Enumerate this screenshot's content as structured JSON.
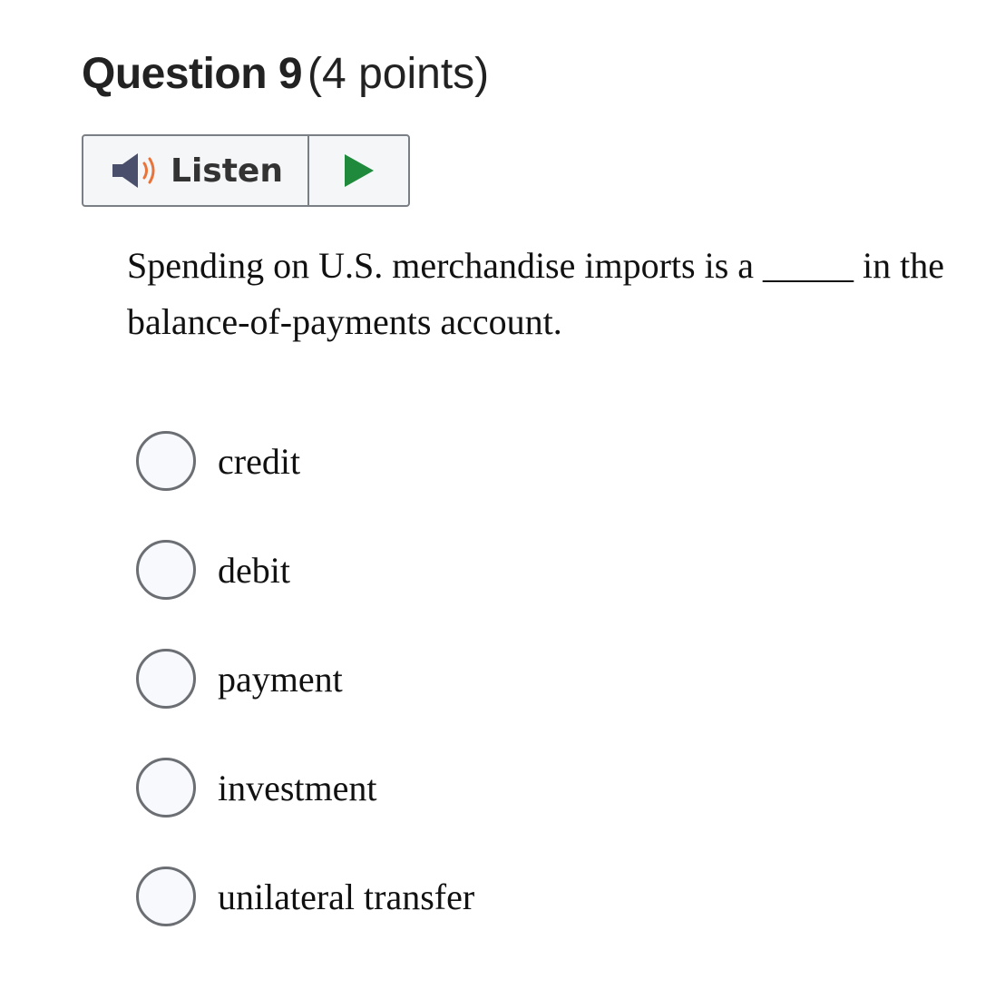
{
  "question": {
    "number_label": "Question 9",
    "points_label": "(4 points)",
    "text": "Spending on U.S. merchandise imports is a _____ in the balance-of-payments account."
  },
  "listen": {
    "label": "Listen",
    "speaker_icon": "speaker-icon",
    "play_icon": "play-icon",
    "speaker_color": "#4a4f6b",
    "waves_color": "#e8743b",
    "play_color": "#1f8a3b"
  },
  "answers": [
    {
      "label": "credit"
    },
    {
      "label": "debit"
    },
    {
      "label": "payment"
    },
    {
      "label": "investment"
    },
    {
      "label": "unilateral transfer"
    }
  ]
}
